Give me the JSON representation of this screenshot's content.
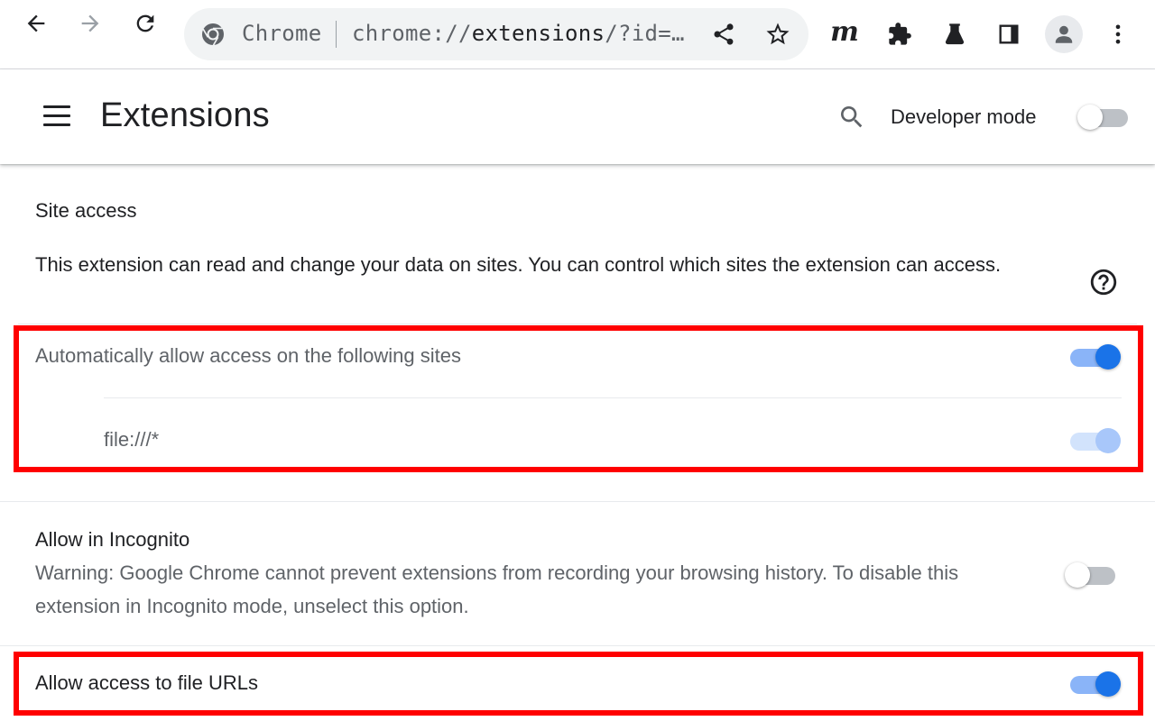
{
  "browser": {
    "site_chip": "Chrome",
    "url_prefix": "chrome://",
    "url_host": "extensions",
    "url_rest": "/?id=…",
    "icons": [
      "back-arrow-icon",
      "forward-arrow-icon",
      "reload-icon",
      "chrome-logo-icon",
      "share-icon",
      "bookmark-star-icon",
      "m-extension-icon",
      "puzzle-piece-icon",
      "flask-icon",
      "side-panel-icon",
      "profile-icon",
      "more-vert-icon"
    ],
    "m_extension_letter": "m"
  },
  "header": {
    "title": "Extensions",
    "developer_mode_label": "Developer mode",
    "developer_mode_on": false
  },
  "site_access": {
    "title": "Site access",
    "description": "This extension can read and change your data on sites. You can control which sites the extension can access.",
    "auto_allow_label": "Automatically allow access on the following sites",
    "auto_allow_on": true,
    "sites": [
      {
        "pattern": "file:///*",
        "enabled": true,
        "disabled": true
      }
    ]
  },
  "incognito": {
    "title": "Allow in Incognito",
    "warning": "Warning: Google Chrome cannot prevent extensions from recording your browsing history. To disable this extension in Incognito mode, unselect this option.",
    "on": false
  },
  "file_urls": {
    "label": "Allow access to file URLs",
    "on": true
  },
  "colors": {
    "accent": "#1a73e8",
    "accent_track": "#8ab4f8",
    "highlight": "#ff0000",
    "text": "#202124",
    "muted_text": "#5f6368"
  }
}
